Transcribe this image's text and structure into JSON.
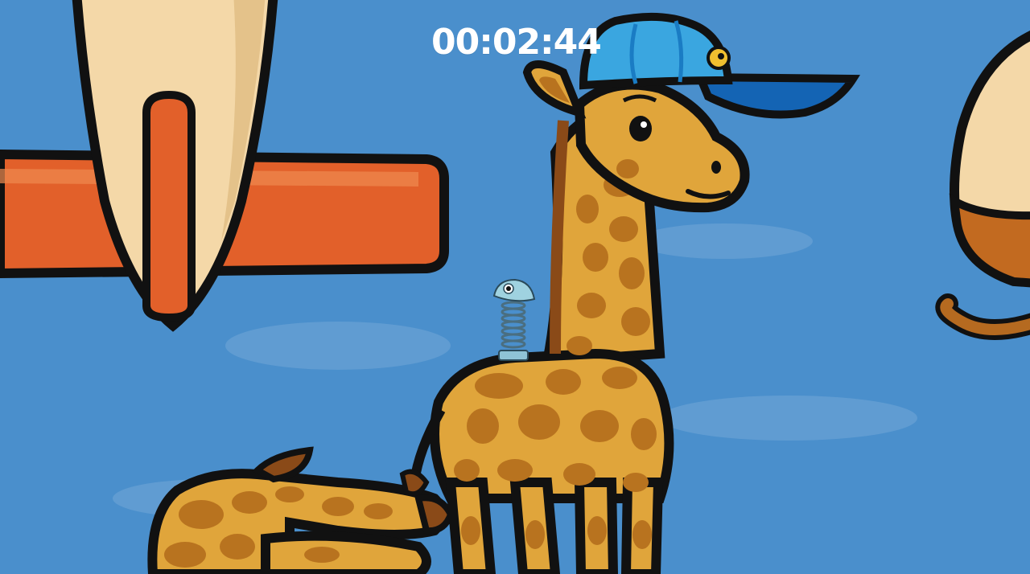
{
  "hud": {
    "timer": "00:02:44"
  },
  "colors": {
    "background": "#4a8fcc",
    "outline": "#111111",
    "giraffe_body": "#e0a53b",
    "giraffe_spots": "#b8731f",
    "cap_main": "#3aa6e0",
    "cap_brim": "#1464b4",
    "plane_body": "#f4d8a8",
    "plane_wing": "#e2602a"
  },
  "scene": {
    "giraffe_cap": "baseball-cap",
    "character": "spring-creature"
  }
}
